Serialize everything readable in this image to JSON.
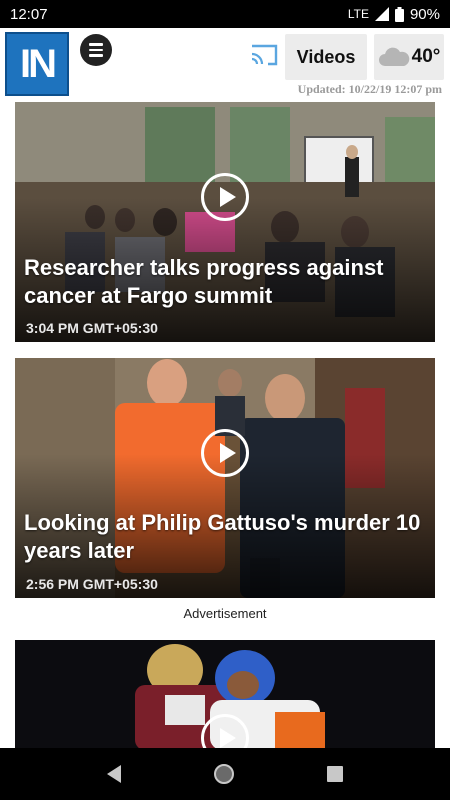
{
  "status_bar": {
    "time": "12:07",
    "network": "LTE",
    "battery": "90%"
  },
  "app_bar": {
    "logo_text": "IN",
    "videos_label": "Videos",
    "weather_temp": "40°",
    "weather_icon": "cloud-icon",
    "cast_icon": "cast-icon",
    "updated_text": "Updated: 10/22/19 12:07 pm"
  },
  "feed": {
    "items": [
      {
        "headline": "Researcher talks progress against cancer at Fargo summit",
        "timestamp": "3:04 PM GMT+05:30",
        "thumbnail": "conference-room-photo",
        "play_icon": "play-icon"
      },
      {
        "headline": "Looking at Philip Gattuso's murder 10 years later",
        "timestamp": "2:56 PM GMT+05:30",
        "thumbnail": "courtroom-photo",
        "play_icon": "play-icon"
      },
      {
        "headline": "",
        "timestamp": "",
        "thumbnail": "football-players-photo",
        "play_icon": "play-icon"
      }
    ],
    "ad_label": "Advertisement"
  },
  "nav_bar": {
    "back_icon": "back-icon",
    "home_icon": "home-icon",
    "recents_icon": "recents-icon"
  },
  "colors": {
    "brand_blue": "#1e73be",
    "status_bar": "#000000",
    "button_bg": "#ececec",
    "updated_text": "#9a9a9a"
  }
}
